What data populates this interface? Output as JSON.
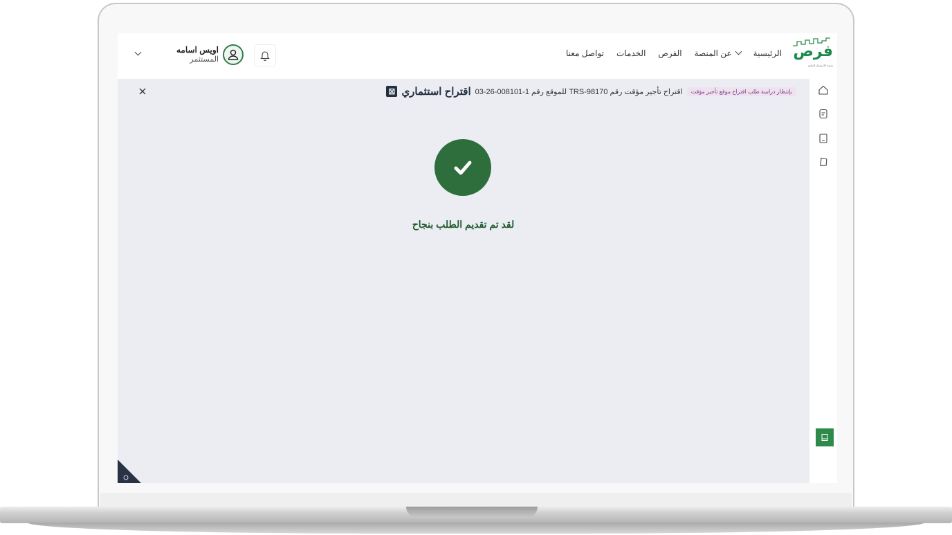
{
  "header": {
    "logo_text": "فرص",
    "logo_tagline": "منصة الاستثمار البلدي",
    "nav": [
      {
        "label": "الرئيسية",
        "dropdown": false
      },
      {
        "label": "عن المنصة",
        "dropdown": true
      },
      {
        "label": "الفرص",
        "dropdown": false
      },
      {
        "label": "الخدمات",
        "dropdown": false
      },
      {
        "label": "تواصل معنا",
        "dropdown": false
      }
    ],
    "user": {
      "name": "اويس اسامه",
      "role": "المستثمر"
    }
  },
  "panel": {
    "badge": "⊠",
    "title": "اقتراح استثماري",
    "subtitle": "اقتراح تأجير مؤقت رقم TRS-98170 للموقع رقم 1-008101-26-03",
    "status": "بإنتظار دراسة طلب اقتراح موقع تأجير مؤقت"
  },
  "result": {
    "message": "لقد تم تقديم الطلب بنجاح"
  },
  "colors": {
    "brand_green": "#2e8a4a",
    "success_circle": "#2e6e3d",
    "panel_bg": "#ebedf3",
    "status_bg": "#efe2ef"
  },
  "icons": [
    "home-icon",
    "clipboard-icon",
    "document-icon",
    "tag-icon",
    "book-icon",
    "bell-icon",
    "user-icon",
    "close-icon",
    "check-icon",
    "settings-icon"
  ]
}
